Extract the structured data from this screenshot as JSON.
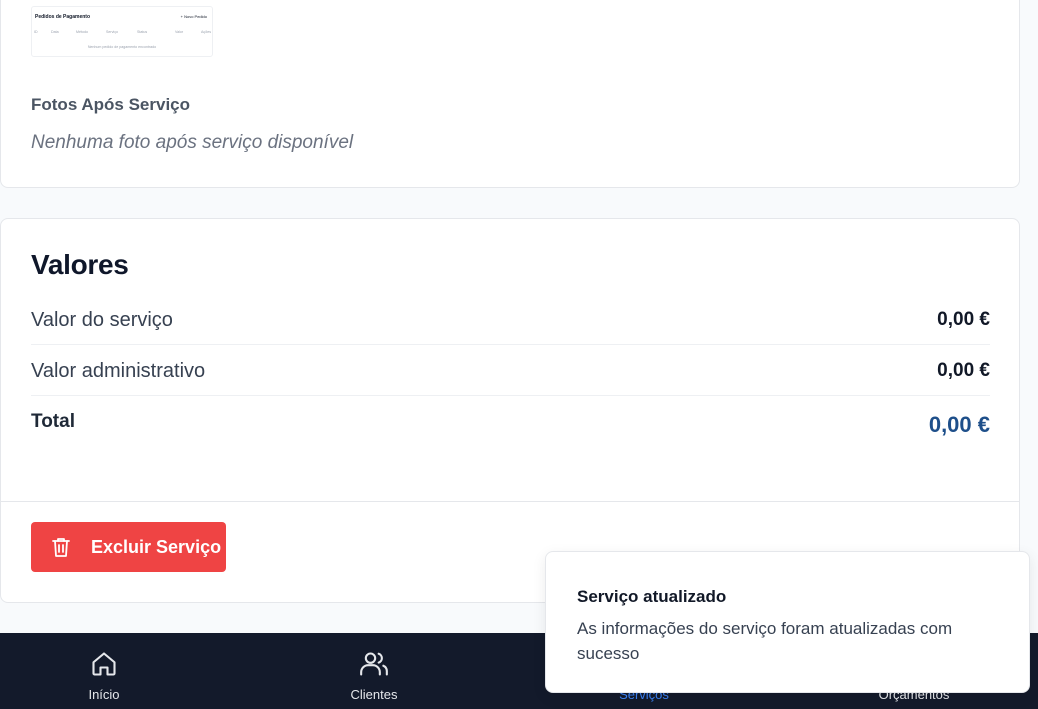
{
  "payment_orders_thumbnail": {
    "title": "Pedidos de Pagamento",
    "new_button": "+ Novo Pedido",
    "columns": [
      "ID",
      "Data",
      "Método",
      "Serviço",
      "Status",
      "Valor",
      "Ações"
    ],
    "empty_text": "Nenhum pedido de pagamento encontrado"
  },
  "photos_after": {
    "label": "Fotos Após Serviço",
    "empty_text": "Nenhuma foto após serviço disponível"
  },
  "values": {
    "title": "Valores",
    "rows": [
      {
        "label": "Valor do serviço",
        "value": "0,00 €"
      },
      {
        "label": "Valor administrativo",
        "value": "0,00 €"
      }
    ],
    "total": {
      "label": "Total",
      "value": "0,00 €"
    }
  },
  "actions": {
    "delete_label": "Excluir Serviço"
  },
  "bottom_nav": {
    "items": [
      {
        "label": "Início",
        "icon": "home-icon"
      },
      {
        "label": "Clientes",
        "icon": "users-icon"
      },
      {
        "label": "Serviços",
        "icon": "wrench-icon",
        "active": true
      },
      {
        "label": "Orçamentos",
        "icon": "document-icon"
      }
    ]
  },
  "toast": {
    "title": "Serviço atualizado",
    "message": "As informações do serviço foram atualizadas com sucesso"
  },
  "colors": {
    "danger": "#ef4444",
    "total_accent": "#1e4f8a",
    "nav_bg": "#131a2b",
    "nav_active": "#3b82f6"
  }
}
